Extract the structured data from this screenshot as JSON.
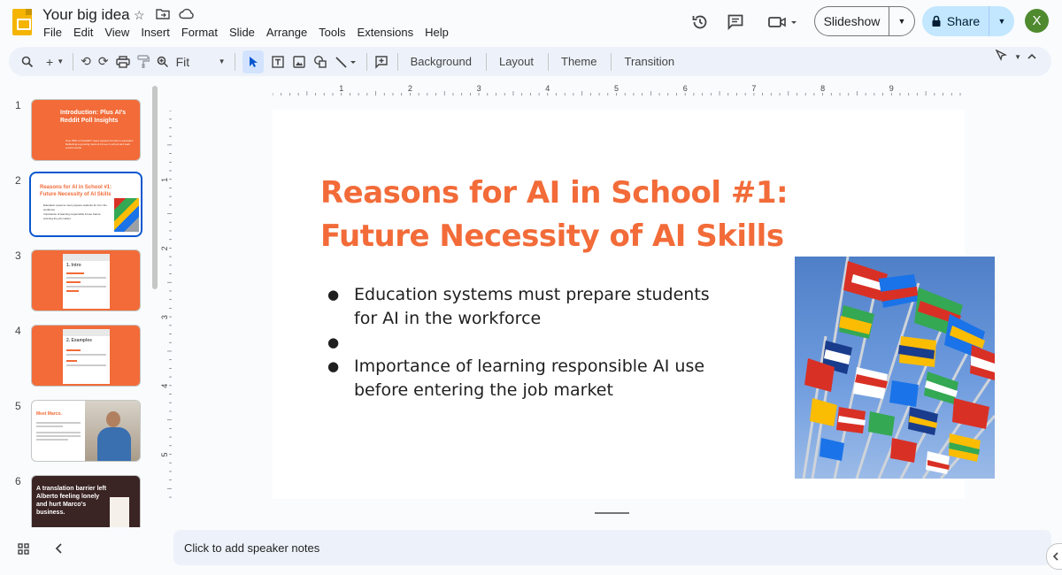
{
  "header": {
    "doc_title": "Your big idea",
    "menu": [
      "File",
      "Edit",
      "View",
      "Insert",
      "Format",
      "Slide",
      "Arrange",
      "Tools",
      "Extensions",
      "Help"
    ],
    "slideshow_label": "Slideshow",
    "share_label": "Share",
    "avatar_letter": "X"
  },
  "toolbar": {
    "zoom_label": "Fit",
    "background_label": "Background",
    "layout_label": "Layout",
    "theme_label": "Theme",
    "transition_label": "Transition"
  },
  "ruler": {
    "horizontal": [
      "1",
      "2",
      "3",
      "4",
      "5",
      "6",
      "7",
      "8",
      "9"
    ],
    "vertical": [
      "1",
      "2",
      "3",
      "4",
      "5"
    ]
  },
  "filmstrip": {
    "slides": [
      {
        "number": "1",
        "title": "Introduction: Plus AI's Reddit Poll Insights",
        "bullets": [
          "Over 85% of ChatGPT users support AI tools in education",
          "Reflecting a growing trend of AI use in school and work environments"
        ]
      },
      {
        "number": "2",
        "title": "Reasons for AI in School #1: Future Necessity of AI Skills",
        "bullets": [
          "Education systems must prepare students for AI in the workforce",
          "Importance of learning responsible AI use before entering the job market"
        ]
      },
      {
        "number": "3",
        "title": "1. Intro"
      },
      {
        "number": "4",
        "title": "2. Examples"
      },
      {
        "number": "5",
        "title": "Meet Marco."
      },
      {
        "number": "6",
        "title": "A translation barrier left Alberto feeling lonely and hurt Marco's business."
      }
    ]
  },
  "slide": {
    "title": "Reasons for AI in School #1: Future Necessity of AI Skills",
    "bullets": [
      "Education systems must prepare students for AI in the workforce",
      "",
      "Importance of learning responsible AI use before entering the job market"
    ]
  },
  "notes": {
    "placeholder": "Click to add speaker notes"
  },
  "colors": {
    "accent": "#f26b38",
    "selection": "#0b57d0",
    "share_bg": "#c2e7ff"
  }
}
